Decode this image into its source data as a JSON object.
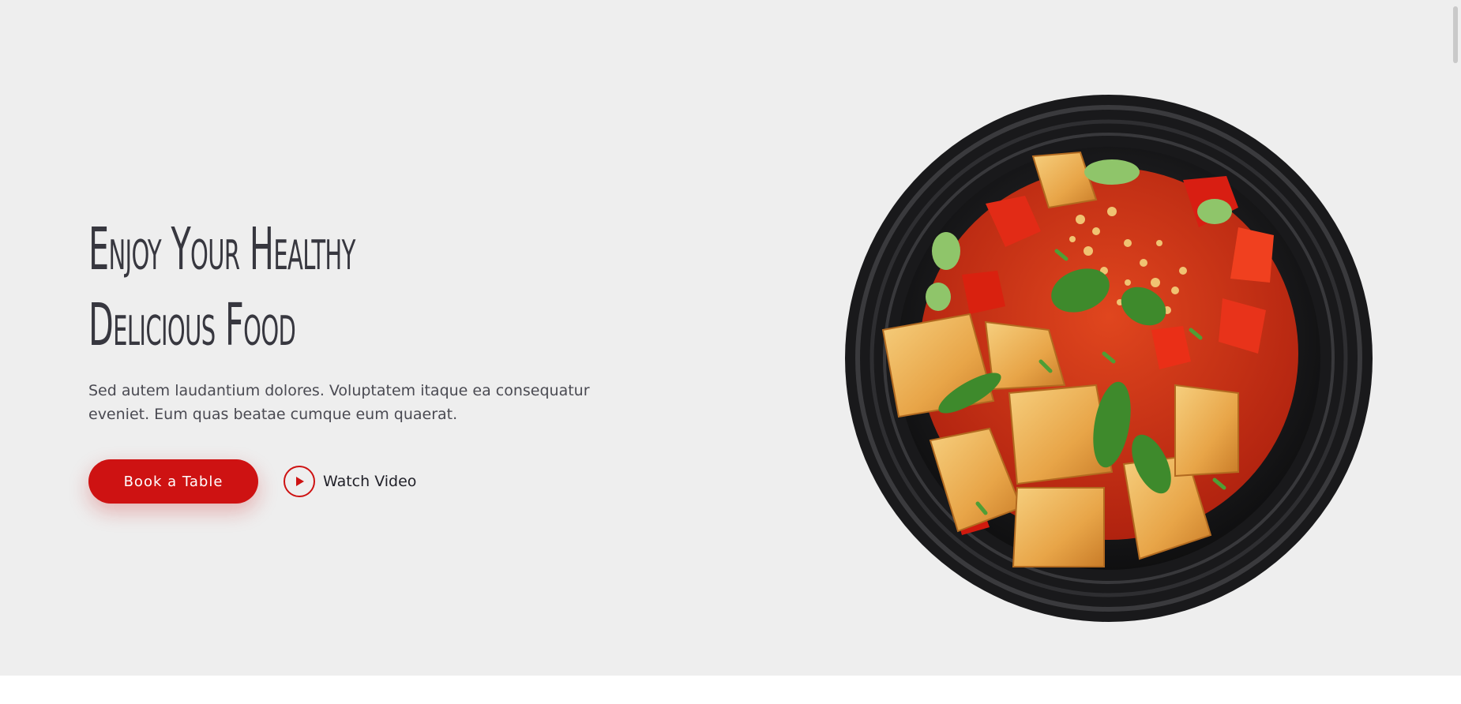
{
  "hero": {
    "headline_line1": "Enjoy Your Healthy",
    "headline_line2": "Delicious Food",
    "description": "Sed autem laudantium dolores. Voluptatem itaque ea consequatur eveniet. Eum quas beatae cumque eum quaerat.",
    "book_button_label": "Book a Table",
    "watch_video_label": "Watch Video",
    "dish_image_alt": "plate of sautéed tofu with peppers and herbs"
  },
  "icons": {
    "play": "play-circle-icon"
  },
  "colors": {
    "accent": "#ce1212",
    "hero_background": "#eeeeee",
    "heading": "#37373f",
    "body_text": "#4a4a52"
  }
}
